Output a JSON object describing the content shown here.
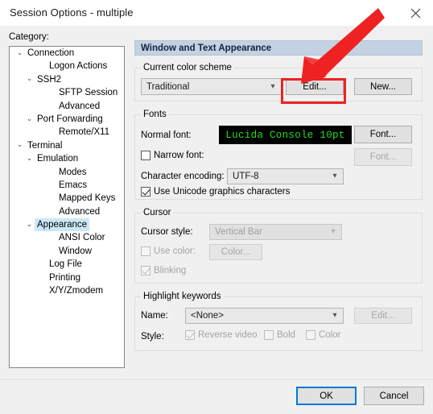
{
  "window": {
    "title": "Session Options - multiple",
    "close_icon": "close-icon"
  },
  "category": {
    "label": "Category:",
    "items": [
      {
        "label": "Connection",
        "depth": 0,
        "chevron": "⌄",
        "selected": false
      },
      {
        "label": "Logon Actions",
        "depth": 2,
        "chevron": "",
        "selected": false
      },
      {
        "label": "SSH2",
        "depth": 1,
        "chevron": "⌄",
        "selected": false
      },
      {
        "label": "SFTP Session",
        "depth": 3,
        "chevron": "",
        "selected": false
      },
      {
        "label": "Advanced",
        "depth": 3,
        "chevron": "",
        "selected": false
      },
      {
        "label": "Port Forwarding",
        "depth": 1,
        "chevron": "⌄",
        "selected": false
      },
      {
        "label": "Remote/X11",
        "depth": 3,
        "chevron": "",
        "selected": false
      },
      {
        "label": "Terminal",
        "depth": 0,
        "chevron": "⌄",
        "selected": false
      },
      {
        "label": "Emulation",
        "depth": 1,
        "chevron": "⌄",
        "selected": false
      },
      {
        "label": "Modes",
        "depth": 3,
        "chevron": "",
        "selected": false
      },
      {
        "label": "Emacs",
        "depth": 3,
        "chevron": "",
        "selected": false
      },
      {
        "label": "Mapped Keys",
        "depth": 3,
        "chevron": "",
        "selected": false
      },
      {
        "label": "Advanced",
        "depth": 3,
        "chevron": "",
        "selected": false
      },
      {
        "label": "Appearance",
        "depth": 1,
        "chevron": "⌄",
        "selected": true
      },
      {
        "label": "ANSI Color",
        "depth": 3,
        "chevron": "",
        "selected": false
      },
      {
        "label": "Window",
        "depth": 3,
        "chevron": "",
        "selected": false
      },
      {
        "label": "Log File",
        "depth": 2,
        "chevron": "",
        "selected": false
      },
      {
        "label": "Printing",
        "depth": 2,
        "chevron": "",
        "selected": false
      },
      {
        "label": "X/Y/Zmodem",
        "depth": 2,
        "chevron": "",
        "selected": false
      }
    ]
  },
  "pane": {
    "header": "Window and Text Appearance",
    "color_scheme": {
      "legend": "Current color scheme",
      "selected": "Traditional",
      "options": [
        "Traditional"
      ],
      "arrow_icon": "chevron-down-icon",
      "edit_label": "Edit...",
      "new_label": "New..."
    },
    "fonts": {
      "legend": "Fonts",
      "normal_font_label": "Normal font:",
      "normal_font_preview": "Lucida Console 10pt",
      "normal_font_button": "Font...",
      "narrow_font_label": "Narrow font:",
      "narrow_font_button": "Font...",
      "encoding_label": "Character encoding:",
      "encoding_value": "UTF-8",
      "encoding_options": [
        "UTF-8"
      ],
      "unicode_graphics_label": "Use Unicode graphics characters"
    },
    "cursor": {
      "legend": "Cursor",
      "style_label": "Cursor style:",
      "style_value": "Vertical Bar",
      "style_options": [
        "Vertical Bar"
      ],
      "use_color_label": "Use color:",
      "color_button": "Color...",
      "blinking_label": "Blinking"
    },
    "highlight": {
      "legend": "Highlight keywords",
      "name_label": "Name:",
      "name_value": "<None>",
      "name_options": [
        "<None>"
      ],
      "edit_label": "Edit...",
      "style_label": "Style:",
      "reverse_video_label": "Reverse video",
      "bold_label": "Bold",
      "color_label": "Color"
    }
  },
  "footer": {
    "ok_label": "OK",
    "cancel_label": "Cancel"
  },
  "annotation": {
    "color": "#ee2222",
    "arrow_icon": "red-arrow-annotation",
    "highlight_icon": "red-box-annotation"
  }
}
